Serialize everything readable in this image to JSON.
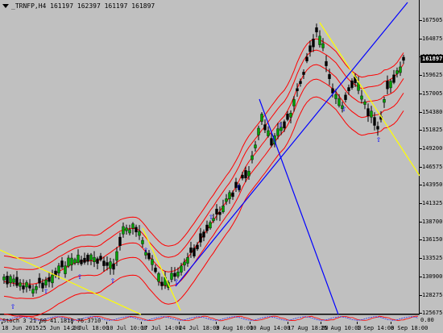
{
  "window": {
    "title": "_TRNFP,H4  161197 162397 161197 161897",
    "current_price": "161897"
  },
  "indicator": {
    "label": "Stoch 3 21 60  41.1818  76.3710",
    "zero_label": "0.00"
  },
  "y_axis": {
    "ticks": [
      "167505",
      "164875",
      "162245",
      "159625",
      "157005",
      "154380",
      "151825",
      "149200",
      "146575",
      "143950",
      "141325",
      "138700",
      "136150",
      "133525",
      "130900",
      "128275",
      "125675"
    ]
  },
  "x_axis": {
    "ticks": [
      "18 Jun 2015",
      "25 Jun 14:00",
      "2 Jul 18:00",
      "10 Jul 10:00",
      "17 Jul 14:00",
      "24 Jul 18:00",
      "3 Aug 10:00",
      "10 Aug 14:00",
      "17 Aug 18:00",
      "25 Aug 10:00",
      "1 Sep 14:00",
      "8 Sep 18:00"
    ]
  },
  "colors": {
    "background": "#c0c0c0",
    "bull_candle": "#00a000",
    "bear_candle": "#000000",
    "bands": "#ff0000",
    "trend_yellow": "#ffff00",
    "trend_blue": "#0000ff",
    "fractal_marker": "#0000ff"
  },
  "chart_data": {
    "type": "candlestick",
    "title": "_TRNFP,H4",
    "ylim": [
      124500,
      168800
    ],
    "approx_close_path": [
      {
        "x": "18 Jun 2015",
        "close": 130000
      },
      {
        "x": "25 Jun 14:00",
        "close": 130400
      },
      {
        "x": "2 Jul 18:00",
        "close": 132800
      },
      {
        "x": "10 Jul 10:00",
        "close": 137000
      },
      {
        "x": "17 Jul 14:00",
        "close": 129500
      },
      {
        "x": "24 Jul 18:00",
        "close": 135000
      },
      {
        "x": "3 Aug 10:00",
        "close": 142500
      },
      {
        "x": "10 Aug 14:00",
        "close": 153000
      },
      {
        "x": "17 Aug 18:00",
        "close": 165000
      },
      {
        "x": "25 Aug 10:00",
        "close": 156000
      },
      {
        "x": "1 Sep 14:00",
        "close": 153500
      },
      {
        "x": "8 Sep 18:00",
        "close": 161897
      }
    ]
  }
}
